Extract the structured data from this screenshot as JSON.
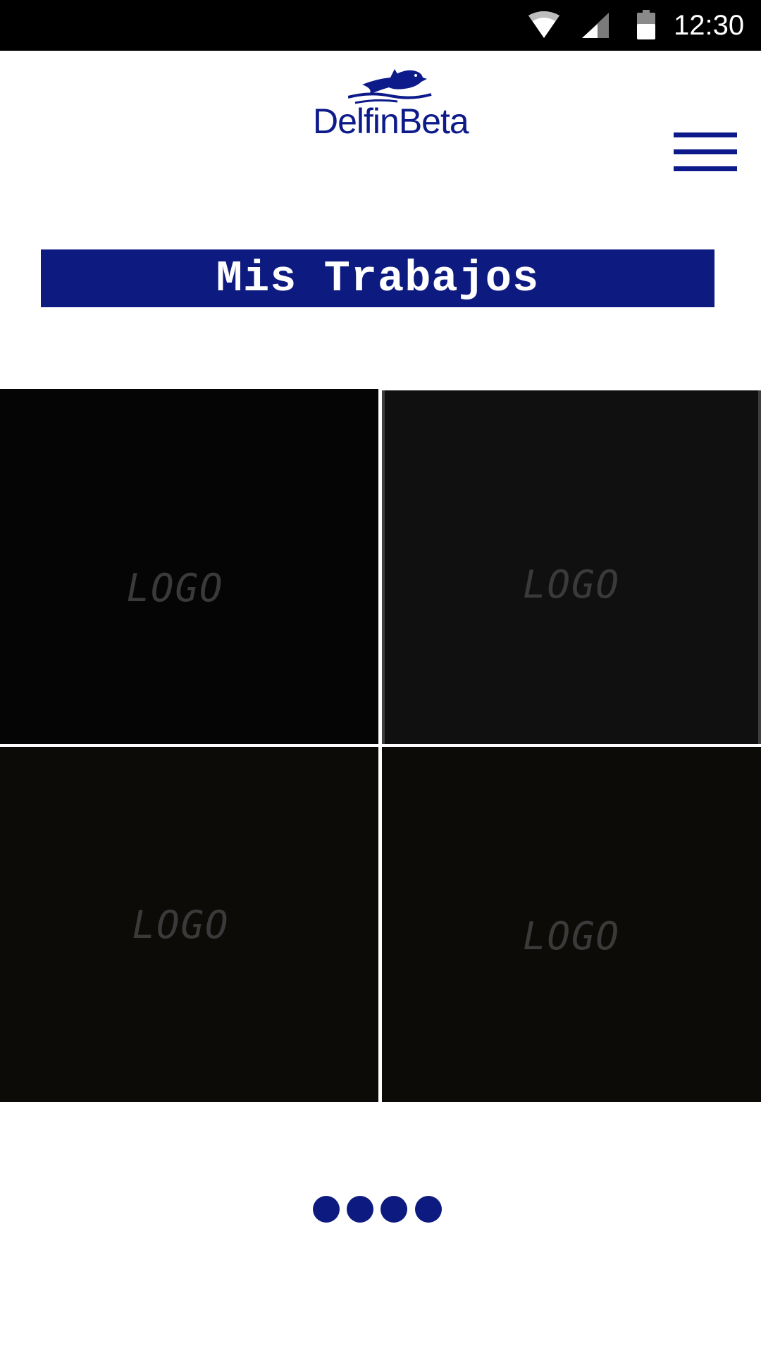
{
  "status_bar": {
    "time": "12:30",
    "icons": [
      "wifi-icon",
      "signal-icon",
      "battery-icon"
    ]
  },
  "header": {
    "logo_text": "DelfinBeta",
    "logo_icon": "dolphin-icon",
    "menu_icon": "hamburger-menu-icon"
  },
  "title": "Mis Trabajos",
  "works": [
    {
      "label": "LOGO"
    },
    {
      "label": "LOGO"
    },
    {
      "label": "LOGO"
    },
    {
      "label": "LOGO"
    }
  ],
  "pager": {
    "page_count": 4
  },
  "colors": {
    "brand": "#0d1a80",
    "tile_text": "#3a3a3a",
    "status_bar": "#000000"
  }
}
